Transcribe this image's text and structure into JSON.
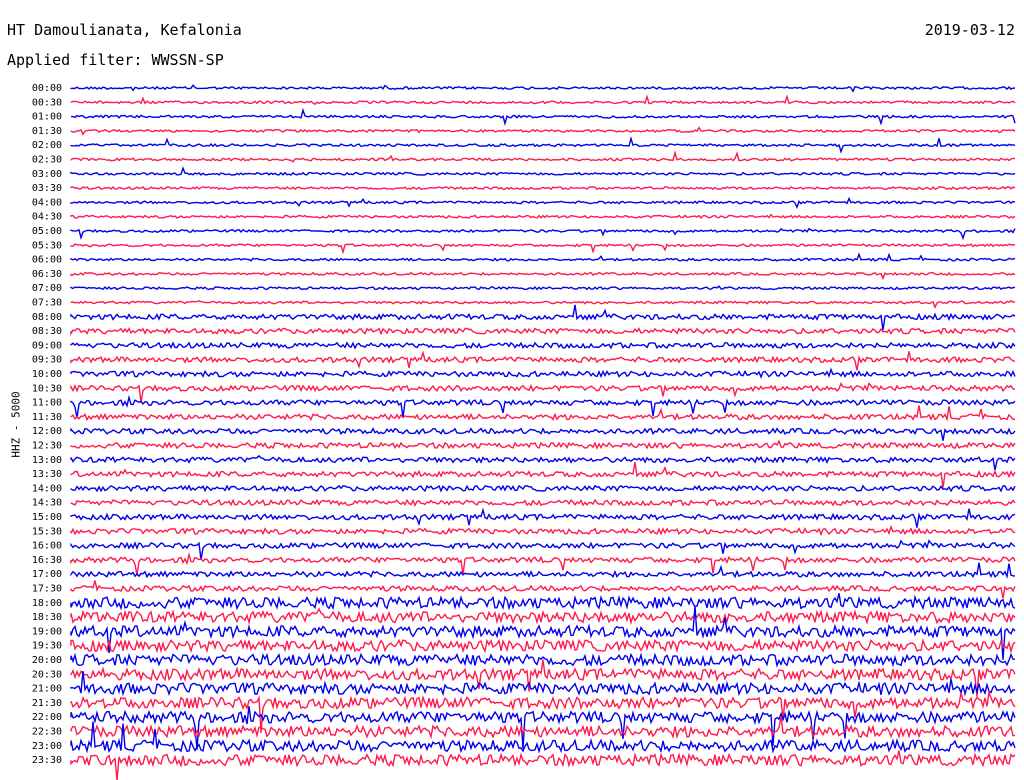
{
  "header": {
    "station": "HT Damoulianata, Kefalonia",
    "date": "2019-03-12",
    "filter": "Applied filter: WWSSN-SP"
  },
  "chart_data": {
    "type": "line",
    "ylabel": "HHZ - 5000",
    "colors": [
      "#0000ee",
      "#ff1a4d"
    ],
    "times": [
      "00:00",
      "00:30",
      "01:00",
      "01:30",
      "02:00",
      "02:30",
      "03:00",
      "03:30",
      "04:00",
      "04:30",
      "05:00",
      "05:30",
      "06:00",
      "06:30",
      "07:00",
      "07:30",
      "08:00",
      "08:30",
      "09:00",
      "09:30",
      "10:00",
      "10:30",
      "11:00",
      "11:30",
      "12:00",
      "12:30",
      "13:00",
      "13:30",
      "14:00",
      "14:30",
      "15:00",
      "15:30",
      "16:00",
      "16:30",
      "17:00",
      "17:30",
      "18:00",
      "18:30",
      "19:00",
      "19:30",
      "20:00",
      "20:30",
      "21:00",
      "21:30",
      "22:00",
      "22:30",
      "23:00",
      "23:30"
    ]
  }
}
